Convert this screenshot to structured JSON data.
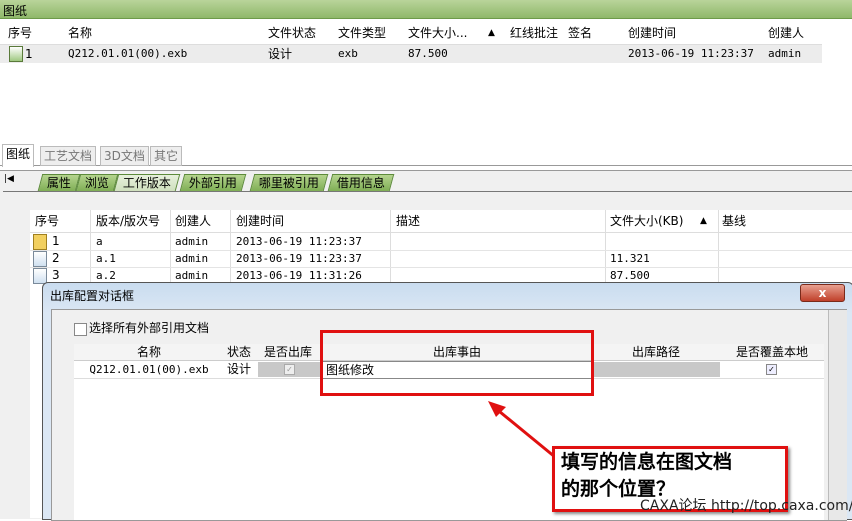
{
  "top_panel": {
    "title": "图纸",
    "columns": [
      "序号",
      "名称",
      "文件状态",
      "文件类型",
      "文件大小...",
      "▲",
      "红线批注",
      "签名",
      "创建时间",
      "创建人"
    ],
    "rows": [
      {
        "no": "1",
        "name": "Q212.01.01(00).exb",
        "status": "设计",
        "type": "exb",
        "size": "87.500",
        "created": "2013-06-19 11:23:37",
        "creator": "admin"
      }
    ]
  },
  "doc_tabs": [
    "图纸",
    "工艺文档",
    "3D文档",
    "其它"
  ],
  "detail_tabs": [
    "属性",
    "浏览",
    "工作版本",
    "外部引用",
    "哪里被引用",
    "借用信息"
  ],
  "detail_nav_icon": "first-page-icon",
  "versions": {
    "columns": [
      "序号",
      "版本/版次号",
      "创建人",
      "创建时间",
      "描述",
      "文件大小(KB)",
      "▲",
      "基线"
    ],
    "rows": [
      {
        "no": "1",
        "ver": "a",
        "creator": "admin",
        "created": "2013-06-19 11:23:37",
        "size": ""
      },
      {
        "no": "2",
        "ver": "a.1",
        "creator": "admin",
        "created": "2013-06-19 11:23:37",
        "size": "11.321"
      },
      {
        "no": "3",
        "ver": "a.2",
        "creator": "admin",
        "created": "2013-06-19 11:31:26",
        "size": "87.500"
      }
    ]
  },
  "dialog": {
    "title": "出库配置对话框",
    "close": "x",
    "select_all_label": "选择所有外部引用文档",
    "columns": [
      "名称",
      "状态",
      "是否出库",
      "出库事由",
      "出库路径",
      "是否覆盖本地"
    ],
    "row": {
      "name": "Q212.01.01(00).exb",
      "status": "设计",
      "reason": "图纸修改",
      "path": ""
    }
  },
  "annotation": {
    "line1": "填写的信息在图文档",
    "line2": "的那个位置？"
  },
  "watermark": "CAXA论坛 http://top.caxa.com/"
}
